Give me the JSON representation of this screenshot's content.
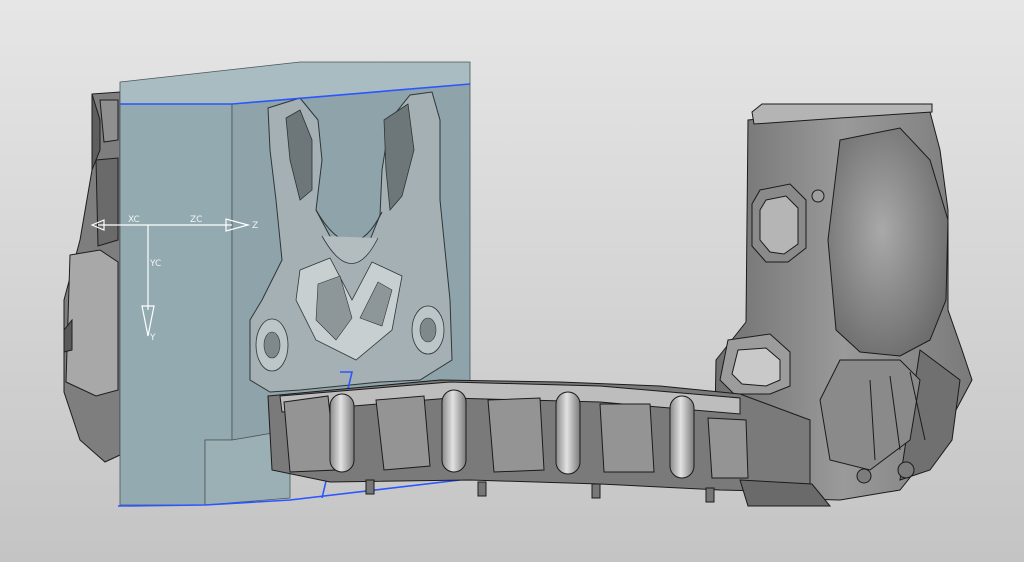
{
  "viewport": {
    "background_top": "#e6e6e6",
    "background_bottom": "#c4c4c4",
    "model_edge_color": "#1d1d1d",
    "mold_block_color": "#93aab0",
    "selection_color": "#2b55ff"
  },
  "triad": {
    "xc_label": "XC",
    "zc_label": "ZC",
    "z_label": "Z",
    "yc_label": "YC",
    "y_label": "Y"
  }
}
